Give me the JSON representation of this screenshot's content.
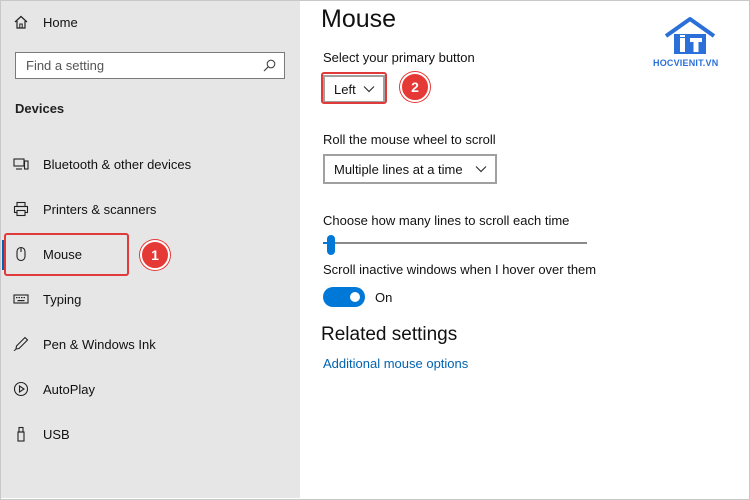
{
  "sidebar": {
    "home_label": "Home",
    "search_placeholder": "Find a setting",
    "section_title": "Devices",
    "items": [
      {
        "label": "Bluetooth & other devices",
        "icon": "bluetooth-devices-icon"
      },
      {
        "label": "Printers & scanners",
        "icon": "printer-icon"
      },
      {
        "label": "Mouse",
        "icon": "mouse-icon",
        "selected": true
      },
      {
        "label": "Typing",
        "icon": "keyboard-icon"
      },
      {
        "label": "Pen & Windows Ink",
        "icon": "pen-icon"
      },
      {
        "label": "AutoPlay",
        "icon": "autoplay-icon"
      },
      {
        "label": "USB",
        "icon": "usb-icon"
      }
    ]
  },
  "main": {
    "title": "Mouse",
    "primary_button": {
      "label": "Select your primary button",
      "value": "Left"
    },
    "scroll_wheel": {
      "label": "Roll the mouse wheel to scroll",
      "value": "Multiple lines at a time"
    },
    "lines_to_scroll": {
      "label": "Choose how many lines to scroll each time",
      "value_fraction": 0.03
    },
    "inactive_scroll": {
      "label": "Scroll inactive windows when I hover over them",
      "state": "On"
    },
    "related_title": "Related settings",
    "related_link": "Additional mouse options"
  },
  "annotations": {
    "badge1": "1",
    "badge2": "2",
    "color": "#e53935"
  },
  "logo": {
    "text": "HOCVIENIT.VN",
    "color": "#2a70d8"
  },
  "colors": {
    "accent": "#0078d7",
    "link": "#0063b1",
    "sidebar_bg": "#e6e6e6"
  }
}
